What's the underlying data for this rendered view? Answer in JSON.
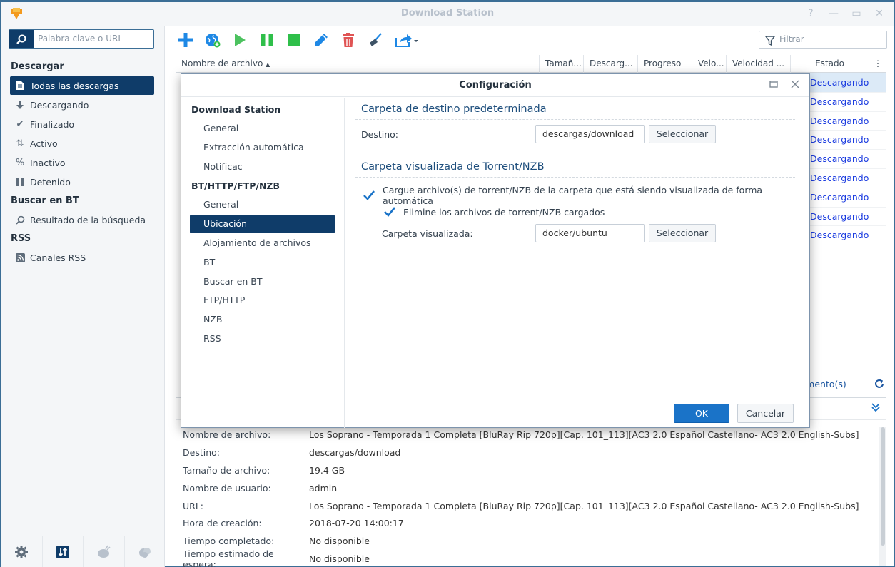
{
  "window": {
    "title": "Download Station"
  },
  "sidebar": {
    "search_placeholder": "Palabra clave o URL",
    "sections": [
      {
        "title": "Descargar"
      },
      {
        "title": "Buscar en BT"
      },
      {
        "title": "RSS"
      }
    ],
    "items": [
      {
        "label": "Todas las descargas",
        "icon": "document-icon",
        "active": true
      },
      {
        "label": "Descargando",
        "icon": "download-arrow-icon"
      },
      {
        "label": "Finalizado",
        "icon": "checkmark-icon"
      },
      {
        "label": "Activo",
        "icon": "up-down-arrows-icon"
      },
      {
        "label": "Inactivo",
        "icon": "percent-icon"
      },
      {
        "label": "Detenido",
        "icon": "pause-icon"
      },
      {
        "label": "Resultado de la búsqueda",
        "icon": "magnifier-icon"
      },
      {
        "label": "Canales RSS",
        "icon": "rss-icon"
      }
    ]
  },
  "toolbar": {
    "filter_placeholder": "Filtrar"
  },
  "table": {
    "columns": [
      "Nombre de archivo",
      "Tamañ...",
      "Descarg...",
      "Progreso",
      "Velo...",
      "Velocidad ...",
      "Estado"
    ],
    "status_values": [
      "Descargando",
      "Descargando",
      "Descargando",
      "Descargando",
      "Descargando",
      "Descargando",
      "Descargando",
      "Descargando",
      "Descargando"
    ],
    "count_text": "lemento(s)"
  },
  "details": [
    {
      "label": "Nombre de archivo:",
      "value": "Los Soprano - Temporada 1 Completa [BluRay Rip 720p][Cap. 101_113][AC3 2.0 Español Castellano- AC3 2.0 English-Subs]"
    },
    {
      "label": "Destino:",
      "value": "descargas/download"
    },
    {
      "label": "Tamaño de archivo:",
      "value": "19.4 GB"
    },
    {
      "label": "Nombre de usuario:",
      "value": "admin"
    },
    {
      "label": "URL:",
      "value": "Los Soprano - Temporada 1 Completa [BluRay Rip 720p][Cap. 101_113][AC3 2.0 Español Castellano- AC3 2.0 English-Subs]"
    },
    {
      "label": "Hora de creación:",
      "value": "2018-07-20 14:00:17"
    },
    {
      "label": "Tiempo completado:",
      "value": "No disponible"
    },
    {
      "label": "Tiempo estimado de espera:",
      "value": "No disponible"
    }
  ],
  "dialog": {
    "title": "Configuración",
    "nav_sections": [
      "Download Station",
      "BT/HTTP/FTP/NZB"
    ],
    "nav_items_ds": [
      "General",
      "Extracción automática",
      "Notificac"
    ],
    "nav_items_bt": [
      "General",
      "Ubicación",
      "Alojamiento de archivos",
      "BT",
      "Buscar en BT",
      "FTP/HTTP",
      "NZB",
      "RSS"
    ],
    "section1": {
      "title": "Carpeta de destino predeterminada",
      "dest_label": "Destino:",
      "dest_value": "descargas/download",
      "select_label": "Seleccionar"
    },
    "section2": {
      "title": "Carpeta visualizada de Torrent/NZB",
      "check1_label": "Cargue archivo(s) de torrent/NZB de la carpeta que está siendo visualizada de forma automática",
      "check1_checked": true,
      "check2_label": "Elimine los archivos de torrent/NZB cargados",
      "check2_checked": true,
      "folder_label": "Carpeta visualizada:",
      "folder_value": "docker/ubuntu",
      "select_label": "Seleccionar"
    },
    "ok_label": "OK",
    "cancel_label": "Cancelar"
  },
  "colors": {
    "accent": "#0f3c69",
    "primary_button": "#1a73c8",
    "status_link": "#1a3be0",
    "toolbar_add": "#1e88e5",
    "toolbar_play": "#2fbf4a",
    "toolbar_delete": "#e05454"
  }
}
